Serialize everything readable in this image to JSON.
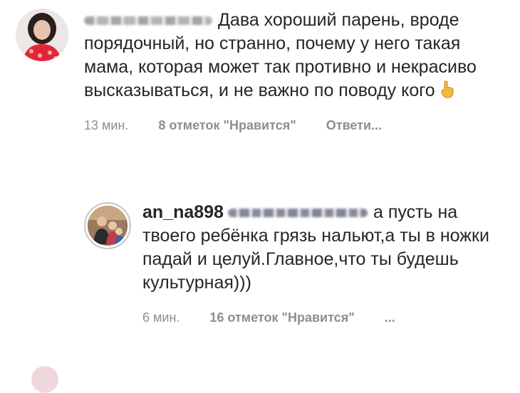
{
  "comment1": {
    "username": "",
    "text": "Дава хороший парень, вроде порядочный,  но странно, почему у него такая мама, которая может так противно и некрасиво высказываться, и не важно по поводу кого",
    "emoji": "index-finger-up",
    "time": "13 мин.",
    "likes": "8 отметок \"Нравится\"",
    "reply": "Ответи..."
  },
  "comment2": {
    "username": "an_na898",
    "mention": "@...",
    "text": "а пусть на твоего ребёнка грязь нальют,а ты в ножки падай и целуй.Главное,что ты будешь культурная)))",
    "time": "6 мин.",
    "likes": "16 отметок \"Нравится\"",
    "more": "..."
  },
  "colors": {
    "text": "#262626",
    "meta": "#8e8e8e"
  }
}
